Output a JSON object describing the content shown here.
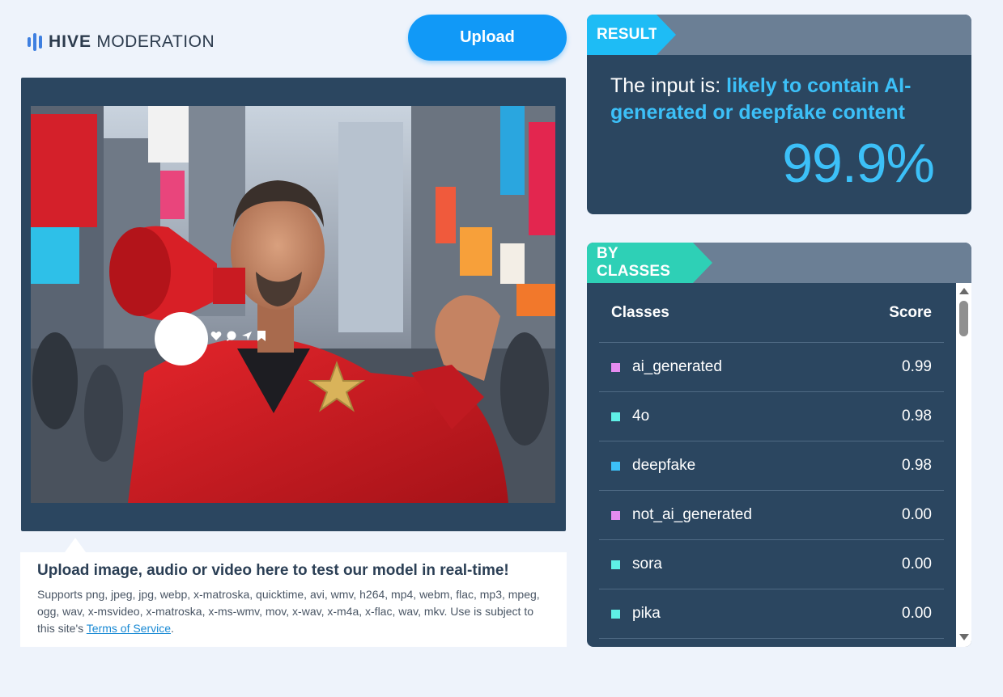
{
  "brand": {
    "bold": "HIVE",
    "light": " MODERATION"
  },
  "upload_button": "Upload",
  "image": {
    "alt": "Man in red coat holding a red megaphone on a city street",
    "reactions": [
      "heart-icon",
      "comment-icon",
      "share-icon",
      "bookmark-icon"
    ]
  },
  "info": {
    "title": "Upload image, audio or video here to test our model in real-time!",
    "desc_prefix": "Supports png, jpeg, jpg, webp, x-matroska, quicktime, avi, wmv, h264, mp4, webm, flac, mp3, mpeg, ogg, wav, x-msvideo, x-matroska, x-ms-wmv, mov, x-wav, x-m4a, x-flac, wav, mkv. Use is subject to this site's ",
    "tos_link": "Terms of Service",
    "desc_suffix": "."
  },
  "result": {
    "tag": "RESULT",
    "prefix": "The input is: ",
    "verdict": "likely to contain AI-generated or deepfake content",
    "percent": "99.9%"
  },
  "classes": {
    "tag": "BY CLASSES",
    "col_class": "Classes",
    "col_score": "Score",
    "rows": [
      {
        "name": "ai_generated",
        "score": "0.99",
        "color": "#e58cf0"
      },
      {
        "name": "4o",
        "score": "0.98",
        "color": "#5ff0e6"
      },
      {
        "name": "deepfake",
        "score": "0.98",
        "color": "#3cc0f8"
      },
      {
        "name": "not_ai_generated",
        "score": "0.00",
        "color": "#e58cf0"
      },
      {
        "name": "sora",
        "score": "0.00",
        "color": "#5ff0e6"
      },
      {
        "name": "pika",
        "score": "0.00",
        "color": "#5ff0e6"
      }
    ]
  },
  "colors": {
    "accent": "#1199f7",
    "panel": "#2b4660",
    "result_tag": "#1ebcf5",
    "classes_tag": "#2ed0b6"
  }
}
